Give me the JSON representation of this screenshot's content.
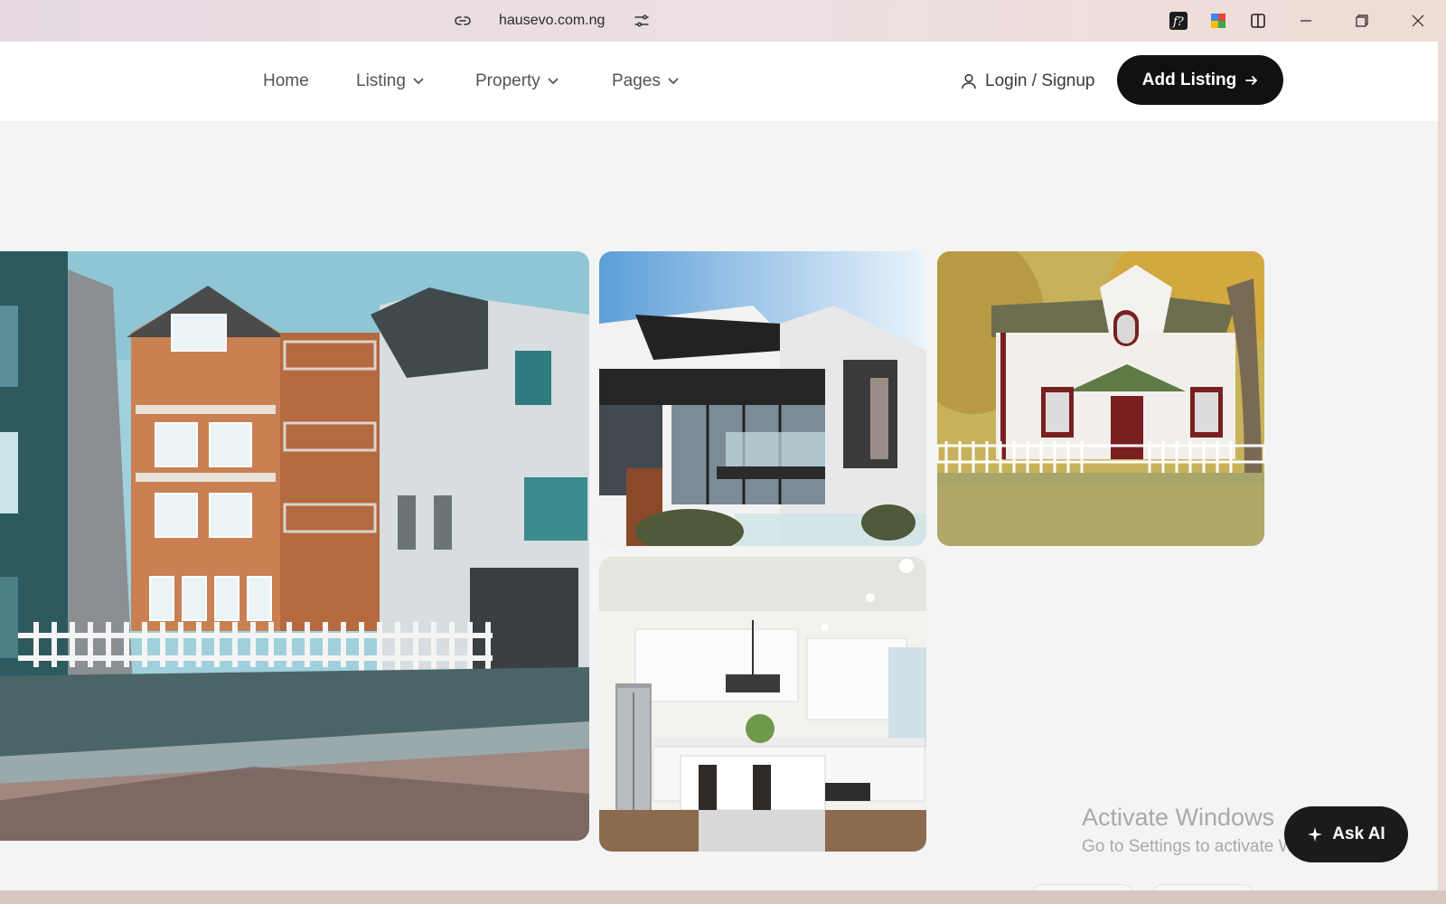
{
  "browser": {
    "url": "hausevo.com.ng",
    "icons": [
      "link-icon",
      "tune-icon",
      "font-extension-icon",
      "puzzle-extension-icon",
      "split-view-icon",
      "minimize-icon",
      "restore-icon",
      "close-icon"
    ]
  },
  "nav": {
    "home": "Home",
    "listing": "Listing",
    "property": "Property",
    "pages": "Pages",
    "login": "Login / Signup",
    "add_listing": "Add Listing"
  },
  "gallery": {
    "images": [
      "street-houses-photo",
      "modern-house-photo",
      "kitchen-photo",
      "white-cottage-photo"
    ]
  },
  "overlay": {
    "activate_title": "Activate Windows",
    "activate_sub": "Go to Settings to activate Windows."
  },
  "ask_ai": "Ask AI",
  "colors": {
    "primary_button": "#111111",
    "page_bg": "#f4f4f4",
    "nav_text": "#545454"
  }
}
